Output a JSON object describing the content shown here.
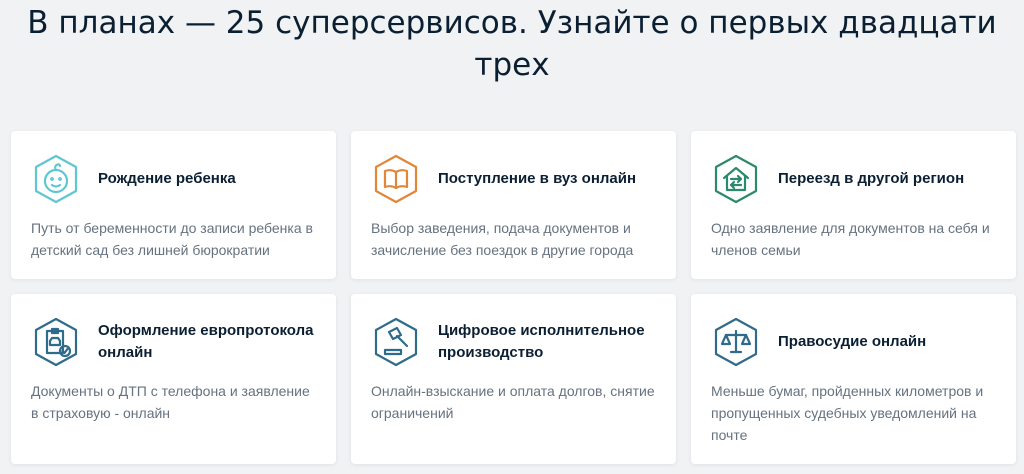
{
  "page": {
    "title": "В планах — 25 суперсервисов. Узнайте о первых двадцати трех"
  },
  "colors": {
    "birth": "#5fc6d3",
    "education": "#e0873a",
    "relocation": "#2c8a6c",
    "accident": "#2f6b8a",
    "enforcement": "#2f6b8a",
    "justice": "#2f6b8a"
  },
  "cards": [
    {
      "icon": "baby-face-icon",
      "title": "Рождение ребенка",
      "description": "Путь от беременности до записи ребенка в детский сад без лишней бюрократии"
    },
    {
      "icon": "open-book-icon",
      "title": "Поступление в вуз онлайн",
      "description": "Выбор заведения, подача документов и зачисление без поездок в другие города"
    },
    {
      "icon": "house-arrows-icon",
      "title": "Переезд в другой регион",
      "description": "Одно заявление для документов на себя и членов семьи"
    },
    {
      "icon": "car-document-icon",
      "title": "Оформление европротокола онлайн",
      "description": "Документы о ДТП с телефона и заявление в страховую - онлайн"
    },
    {
      "icon": "gavel-icon",
      "title": "Цифровое исполнительное производство",
      "description": "Онлайн-взыскание и оплата долгов, снятие ограничений"
    },
    {
      "icon": "scales-icon",
      "title": "Правосудие онлайн",
      "description": "Меньше бумаг, пройденных километров и пропущенных судебных уведомлений на почте"
    }
  ]
}
